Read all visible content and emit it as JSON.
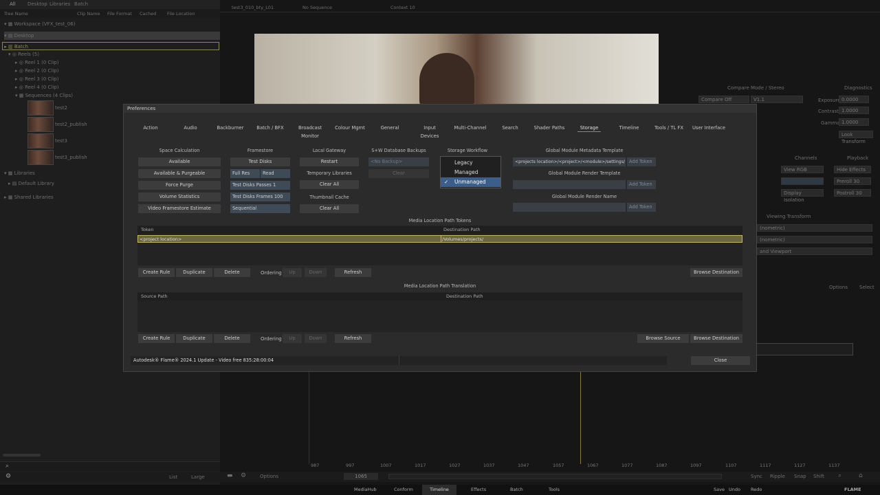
{
  "left_panel": {
    "top_tabs": [
      "All",
      "Desktop",
      "Libraries",
      "Batch"
    ],
    "columns": [
      "Tree Name",
      "Clip Name",
      "File Format",
      "Cached",
      "File Location"
    ],
    "tree": [
      "Workspace (VFX_test_06)",
      "Desktop",
      "Batch",
      "Reels (5)",
      "Reel 1 (0 Clip)",
      "Reel 2 (0 Clip)",
      "Reel 3 (0 Clip)",
      "Reel 4 (0 Clip)",
      "Sequences (4 Clips)"
    ],
    "clips": [
      "test2",
      "test2_publish",
      "test3",
      "test3_publish"
    ],
    "libraries": "Libraries",
    "default_library": "Default Library",
    "shared_libraries": "Shared Libraries",
    "footer": {
      "list": "List",
      "large": "Large"
    }
  },
  "viewer": {
    "tabs": [
      "test3_010_bty_L01",
      "No Sequence",
      "Context 10"
    ]
  },
  "right_controls": {
    "compare_mode": "Compare Mode / Stereo",
    "compare_off": "Compare Off",
    "v1": "V1.1",
    "diagnostics": "Diagnostics",
    "exposure_label": "Exposure",
    "exposure": "0.0000",
    "contrast_label": "Contrast",
    "contrast": "1.0000",
    "gamma_label": "Gamma",
    "gamma": "1.0000",
    "look_transform": "Look Transform",
    "channels": "Channels",
    "playback": "Playback",
    "view_rgb": "View RGB",
    "hide_effects": "Hide Effects",
    "preroll": "Preroll 30",
    "postroll": "Postroll 30",
    "display_isolation": "Display Isolation",
    "viewing_transform": "Viewing Transform",
    "vt_items": [
      "(nometric)",
      "(nometric)",
      "and Viewport"
    ],
    "options": "Options",
    "select": "Select"
  },
  "timeline": {
    "ruler": [
      "987",
      "997",
      "1007",
      "1017",
      "1027",
      "1037",
      "1047",
      "1057",
      "1067",
      "1077",
      "1087",
      "1097",
      "1107",
      "1117",
      "1127",
      "1137"
    ],
    "frame": "1065",
    "options": "Options",
    "sync": "Sync",
    "ripple": "Ripple",
    "snap": "Snap",
    "shift": "Shift"
  },
  "bottom_bar": {
    "tabs": [
      "MediaHub",
      "Conform",
      "Timeline",
      "Effects",
      "Batch",
      "Tools"
    ],
    "active": "Timeline",
    "save": "Save",
    "undo": "Undo",
    "redo": "Redo",
    "brand": "FLAME"
  },
  "preferences": {
    "title": "Preferences",
    "tabs": [
      "Action",
      "Audio",
      "Backburner",
      "Batch / BFX",
      "Broadcast Monitor",
      "Colour Mgmt",
      "General",
      "Input Devices",
      "Multi-Channel",
      "Search",
      "Shader Paths",
      "Storage",
      "Timeline",
      "Tools / TL FX",
      "User Interface"
    ],
    "active_tab": "Storage",
    "space_calc": {
      "header": "Space Calculation",
      "buttons": [
        "Available",
        "Available & Purgeable",
        "Force Purge",
        "Volume Statistics",
        "Video Framestore Estimate"
      ]
    },
    "framestore": {
      "header": "Framestore",
      "test_disks": "Test Disks",
      "full_res": "Full Res",
      "read": "Read",
      "passes": "Test Disks Passes 1",
      "frames": "Test Disks Frames 100",
      "sequential": "Sequential"
    },
    "local_gateway": {
      "header": "Local Gateway",
      "restart": "Restart",
      "temp_header": "Temporary Libraries",
      "clear_all_1": "Clear All",
      "thumb_header": "Thumbnail Cache",
      "clear_all_2": "Clear All"
    },
    "sw_backups": {
      "header": "S+W Database Backups",
      "no_backup": "<No Backup>",
      "clear": "Clear"
    },
    "storage_workflow": {
      "header": "Storage Workflow",
      "options": [
        "Legacy",
        "Managed",
        "Unmanaged"
      ],
      "selected": "Unmanaged"
    },
    "global_module": {
      "metadata_header": "Global Module Metadata Template",
      "metadata_value": "<projects location>/<project>/<module>/settings/",
      "add_token": "Add Token",
      "render_template_header": "Global Module Render Template",
      "render_name_header": "Global Module Render Name"
    },
    "tokens": {
      "header": "Media Location Path Tokens",
      "col_token": "Token",
      "col_dest": "Destination Path",
      "row_token": "<project location>",
      "row_dest": "/Volumes/projects/",
      "buttons": {
        "create": "Create Rule",
        "duplicate": "Duplicate",
        "delete": "Delete",
        "ordering": "Ordering",
        "up": "Up",
        "down": "Down",
        "refresh": "Refresh",
        "browse_dest": "Browse Destination"
      }
    },
    "translation": {
      "header": "Media Location Path Translation",
      "col_source": "Source Path",
      "col_dest": "Destination Path",
      "buttons": {
        "create": "Create Rule",
        "duplicate": "Duplicate",
        "delete": "Delete",
        "ordering": "Ordering",
        "up": "Up",
        "down": "Down",
        "refresh": "Refresh",
        "browse_source": "Browse Source",
        "browse_dest": "Browse Destination"
      }
    },
    "status": "Autodesk® Flame® 2024.1 Update  - Video free 835:28:00:04",
    "close": "Close"
  }
}
